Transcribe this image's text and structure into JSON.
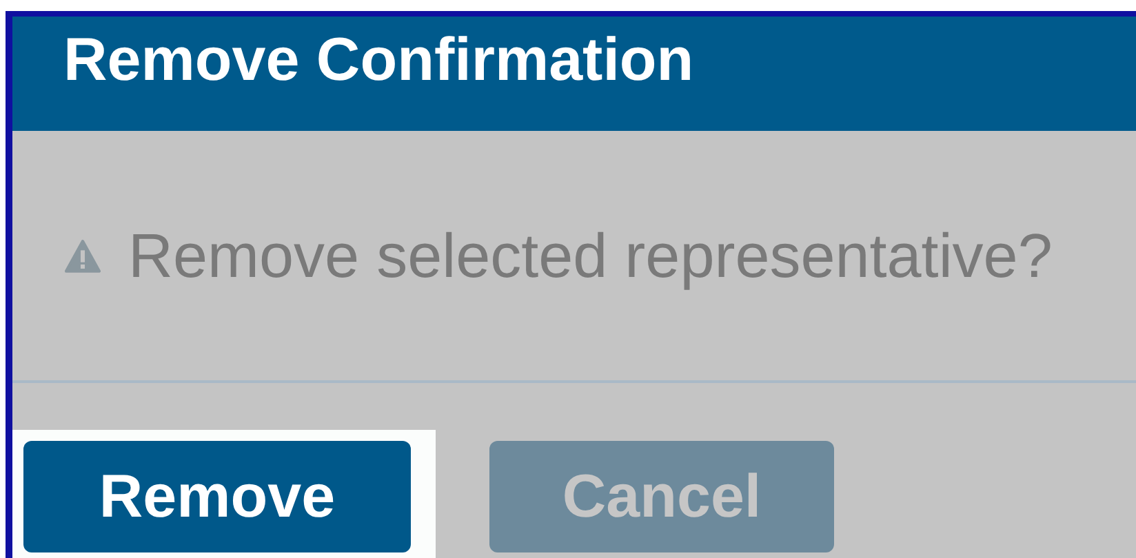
{
  "dialog": {
    "title": "Remove Confirmation",
    "message": {
      "text": "Remove selected representative?"
    },
    "buttons": [
      {
        "label": "Remove",
        "highlighted": true
      },
      {
        "label": "Cancel",
        "highlighted": false
      }
    ]
  }
}
